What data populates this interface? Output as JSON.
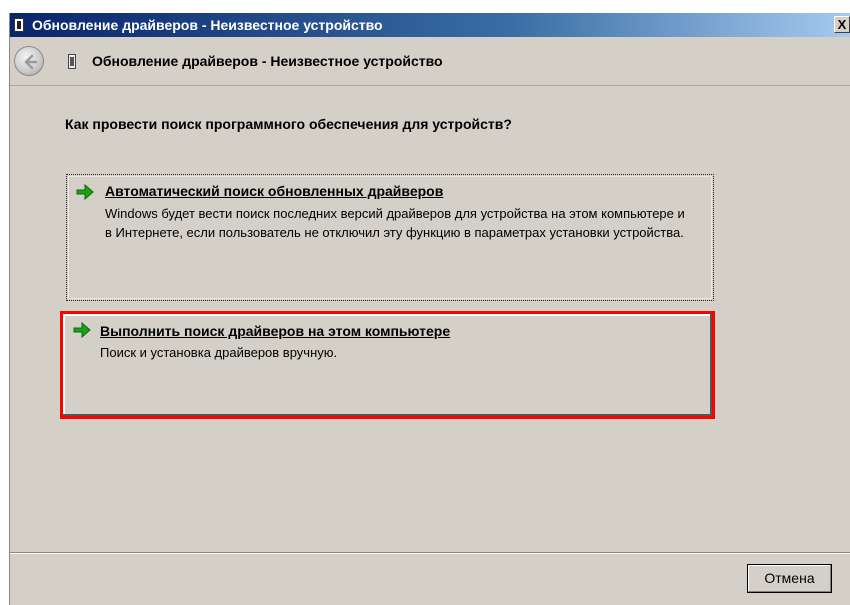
{
  "window": {
    "title": "Обновление драйверов - Неизвестное устройство",
    "close_label": "X"
  },
  "header": {
    "back_icon": "back-arrow-icon",
    "device_icon": "device-icon",
    "title": "Обновление драйверов - Неизвестное устройство"
  },
  "main": {
    "question": "Как провести поиск программного обеспечения для устройств?",
    "options": [
      {
        "icon": "green-arrow-icon",
        "title": "Автоматический поиск обновленных драйверов",
        "description": "Windows будет вести поиск последних версий драйверов для устройства на этом компьютере и в Интернете, если пользователь не отключил эту функцию в параметрах установки устройства."
      },
      {
        "icon": "green-arrow-icon",
        "title": "Выполнить поиск драйверов на этом компьютере",
        "description": "Поиск и установка драйверов вручную.",
        "highlighted": true
      }
    ]
  },
  "footer": {
    "cancel_label": "Отмена"
  },
  "colors": {
    "highlight": "#ff0000",
    "dialog_bg": "#d4d0c8",
    "arrow_green": "#1aa31a"
  }
}
